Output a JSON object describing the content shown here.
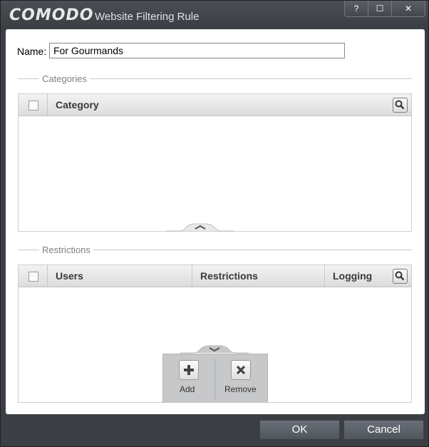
{
  "window": {
    "brand": "COMODO",
    "title": "Website Filtering Rule",
    "buttons": [
      "?",
      "☐",
      "✕"
    ]
  },
  "form": {
    "name_label": "Name:",
    "name_value": "For Gourmands"
  },
  "categories": {
    "section_title": "Categories",
    "columns": [
      "Category"
    ],
    "rows": []
  },
  "restrictions": {
    "section_title": "Restrictions",
    "columns": [
      "Users",
      "Restrictions",
      "Logging"
    ],
    "rows": []
  },
  "actions": {
    "add_label": "Add",
    "remove_label": "Remove"
  },
  "footer": {
    "ok_label": "OK",
    "cancel_label": "Cancel"
  }
}
